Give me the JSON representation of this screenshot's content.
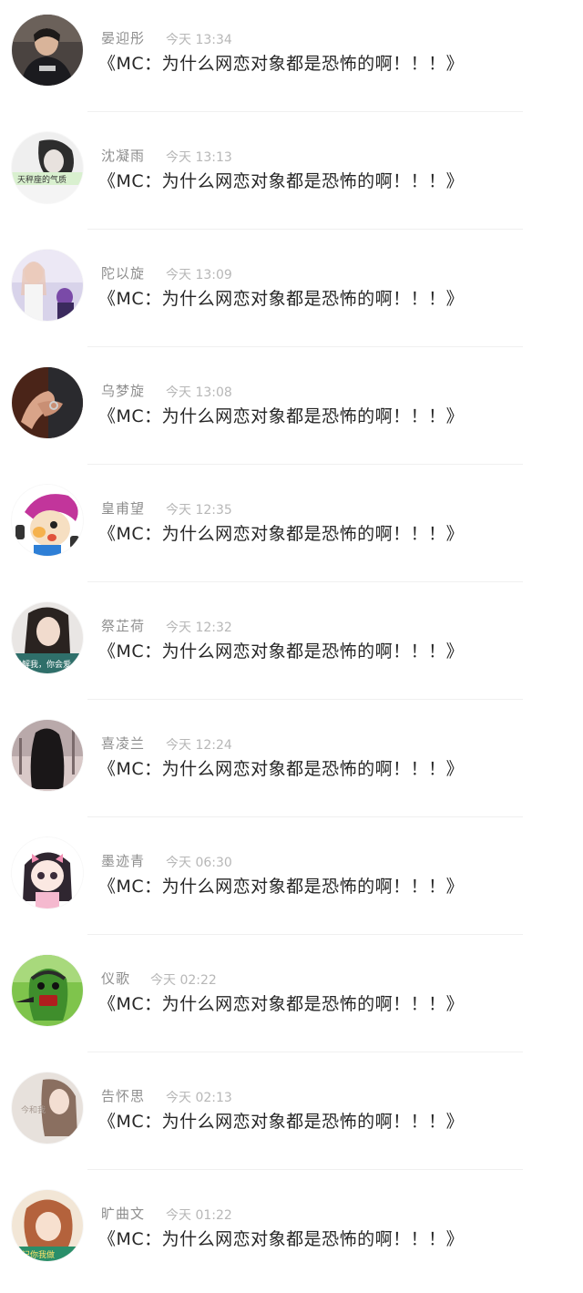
{
  "chats": [
    {
      "name": "晏迎彤",
      "time": "今天 13:34",
      "message": "《MC：为什么网恋对象都是恐怖的啊！！！》",
      "avatar": "person-dark-hoodie-avatar"
    },
    {
      "name": "沈凝雨",
      "time": "今天 13:13",
      "message": "《MC：为什么网恋对象都是恐怖的啊！！！》",
      "avatar": "bw-girl-avatar",
      "avatar_text": "天秤座的气质"
    },
    {
      "name": "陀以旋",
      "time": "今天 13:09",
      "message": "《MC：为什么网恋对象都是恐怖的啊！！！》",
      "avatar": "anime-girls-avatar"
    },
    {
      "name": "乌梦旋",
      "time": "今天 13:08",
      "message": "《MC：为什么网恋对象都是恐怖的啊！！！》",
      "avatar": "hands-avatar"
    },
    {
      "name": "皇甫望",
      "time": "今天 12:35",
      "message": "《MC：为什么网恋对象都是恐怖的啊！！！》",
      "avatar": "cartoon-character-avatar"
    },
    {
      "name": "祭芷荷",
      "time": "今天 12:32",
      "message": "《MC：为什么网恋对象都是恐怖的啊！！！》",
      "avatar": "woman-portrait-avatar",
      "avatar_text": "了解我，你会爱"
    },
    {
      "name": "喜凌兰",
      "time": "今天 12:24",
      "message": "《MC：为什么网恋对象都是恐怖的啊！！！》",
      "avatar": "dark-hair-girl-avatar"
    },
    {
      "name": "墨迹青",
      "time": "今天 06:30",
      "message": "《MC：为什么网恋对象都是恐怖的啊！！！》",
      "avatar": "chibi-girl-avatar"
    },
    {
      "name": "仪歌",
      "time": "今天 02:22",
      "message": "《MC：为什么网恋对象都是恐怖的啊！！！》",
      "avatar": "green-monster-avatar"
    },
    {
      "name": "告怀思",
      "time": "今天 02:13",
      "message": "《MC：为什么网恋对象都是恐怖的啊！！！》",
      "avatar": "soft-portrait-avatar",
      "avatar_text": "今和我"
    },
    {
      "name": "旷曲文",
      "time": "今天 01:22",
      "message": "《MC：为什么网恋对象都是恐怖的啊！！！》",
      "avatar": "short-hair-girl-avatar",
      "avatar_text": "忘记你我做"
    }
  ],
  "colors": {
    "name": "#8e8e8e",
    "time": "#b7b7b7",
    "message": "#262626",
    "divider": "#f0f0f0"
  }
}
